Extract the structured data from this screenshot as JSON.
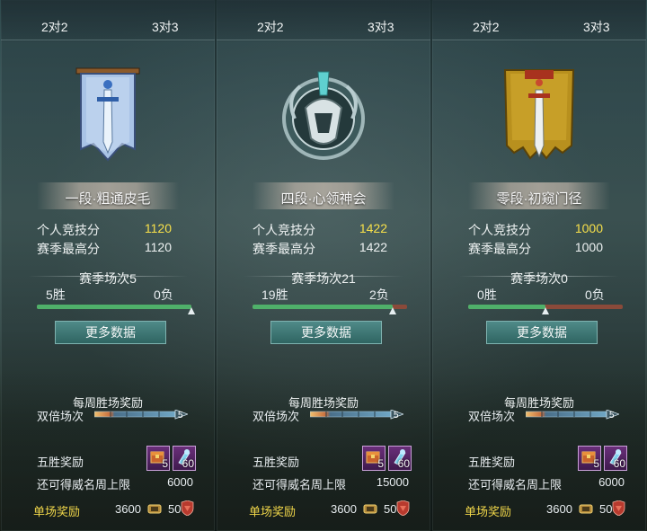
{
  "panels": [
    {
      "tab_2v2": "2对2",
      "tab_3v3": "3对3",
      "rank_title": "一段·粗通皮毛",
      "personal_score_label": "个人竞技分",
      "personal_score": "1120",
      "season_high_label": "赛季最高分",
      "season_high": "1120",
      "season_matches": "赛季场次5",
      "wins": "5胜",
      "losses": "0负",
      "win_ratio": 1.0,
      "more_data": "更多数据",
      "weekly_reward_title": "每周胜场奖励",
      "double_label": "双倍场次",
      "double_count": "5",
      "five_win_label": "五胜奖励",
      "item1_count": "5",
      "item2_count": "60",
      "fame_label": "还可得威名周上限",
      "fame_value": "6000",
      "single_label": "单场奖励",
      "single_value1": "3600",
      "single_value2": "50",
      "emblem": "blue-banner-sword"
    },
    {
      "tab_2v2": "2对2",
      "tab_3v3": "3对3",
      "rank_title": "四段·心领神会",
      "personal_score_label": "个人竞技分",
      "personal_score": "1422",
      "season_high_label": "赛季最高分",
      "season_high": "1422",
      "season_matches": "赛季场次21",
      "wins": "19胜",
      "losses": "2负",
      "win_ratio": 0.905,
      "more_data": "更多数据",
      "weekly_reward_title": "每周胜场奖励",
      "double_label": "双倍场次",
      "double_count": "5",
      "five_win_label": "五胜奖励",
      "item1_count": "5",
      "item2_count": "60",
      "fame_label": "还可得威名周上限",
      "fame_value": "15000",
      "single_label": "单场奖励",
      "single_value1": "3600",
      "single_value2": "50",
      "emblem": "ornate-crest"
    },
    {
      "tab_2v2": "2对2",
      "tab_3v3": "3对3",
      "rank_title": "零段·初窥门径",
      "personal_score_label": "个人竞技分",
      "personal_score": "1000",
      "season_high_label": "赛季最高分",
      "season_high": "1000",
      "season_matches": "赛季场次0",
      "wins": "0胜",
      "losses": "0负",
      "win_ratio": 0.5,
      "more_data": "更多数据",
      "weekly_reward_title": "每周胜场奖励",
      "double_label": "双倍场次",
      "double_count": "5",
      "five_win_label": "五胜奖励",
      "item1_count": "5",
      "item2_count": "60",
      "fame_label": "还可得威名周上限",
      "fame_value": "6000",
      "single_label": "单场奖励",
      "single_value1": "3600",
      "single_value2": "50",
      "emblem": "gold-banner-sword"
    }
  ],
  "colors": {
    "score_highlight": "#f7e04a",
    "single_reward_label": "#f0d64a",
    "win_bar": "#4fb06a",
    "loss_bar": "#8a4a3a",
    "button_bg": "#3f7775"
  }
}
